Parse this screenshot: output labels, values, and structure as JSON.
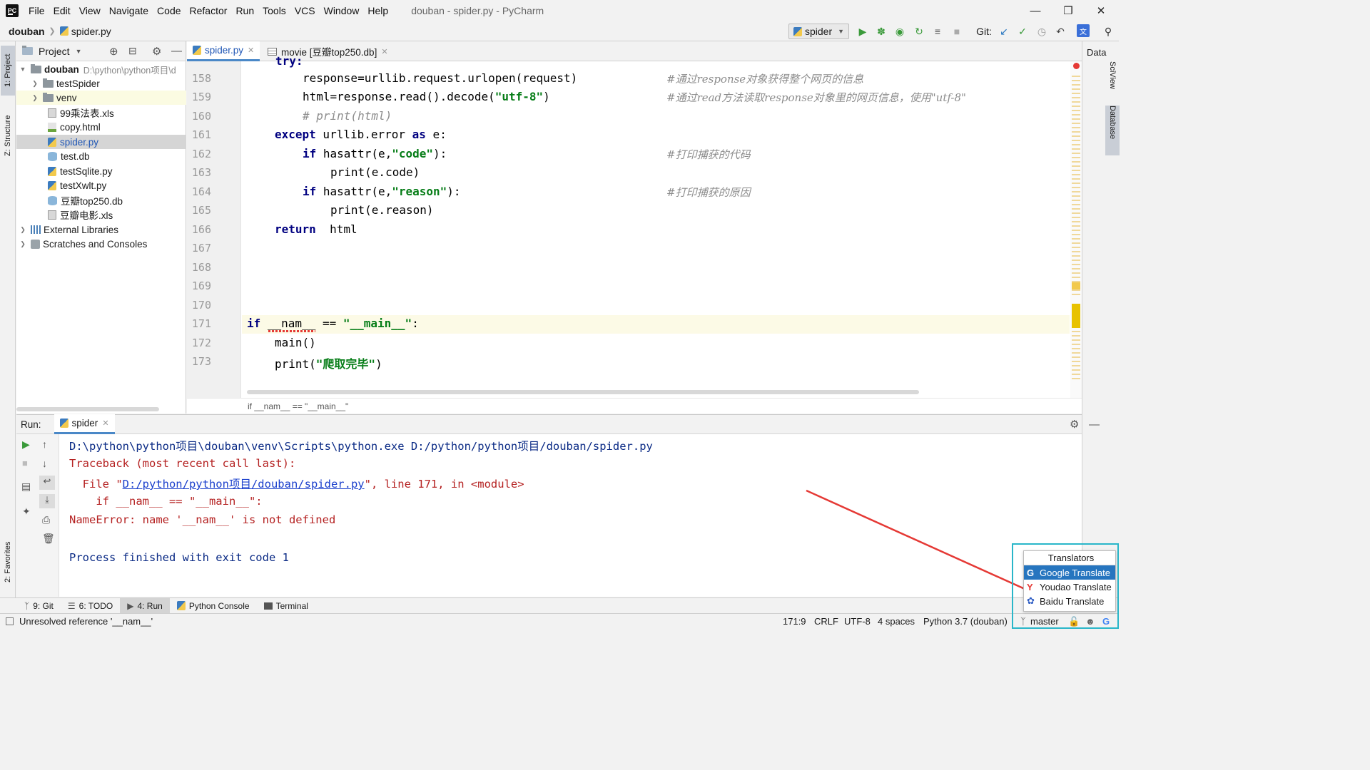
{
  "menu": {
    "items": [
      "File",
      "Edit",
      "View",
      "Navigate",
      "Code",
      "Refactor",
      "Run",
      "Tools",
      "VCS",
      "Window",
      "Help"
    ],
    "window_title": "douban - spider.py - PyCharm"
  },
  "nav": {
    "project": "douban",
    "file": "spider.py",
    "run_config": "spider",
    "git_label": "Git:"
  },
  "left_strip": {
    "project_tab": "1: Project",
    "structure_tab": "Z: Structure",
    "favorites_tab": "2: Favorites"
  },
  "right_strip": {
    "data_label": "Data",
    "sciview_tab": "SciView",
    "database_tab": "Database"
  },
  "project_panel": {
    "title": "Project",
    "tree": [
      {
        "name": "douban",
        "path": "D:\\python\\python项目\\d",
        "type": "root"
      },
      {
        "name": "testSpider",
        "type": "folder"
      },
      {
        "name": "venv",
        "type": "folder"
      },
      {
        "name": "99乘法表.xls",
        "type": "xls"
      },
      {
        "name": "copy.html",
        "type": "html"
      },
      {
        "name": "spider.py",
        "type": "py"
      },
      {
        "name": "test.db",
        "type": "db"
      },
      {
        "name": "testSqlite.py",
        "type": "py"
      },
      {
        "name": "testXwlt.py",
        "type": "py"
      },
      {
        "name": "豆瓣top250.db",
        "type": "db"
      },
      {
        "name": "豆瓣电影.xls",
        "type": "xls"
      },
      {
        "name": "External Libraries",
        "type": "lib"
      },
      {
        "name": "Scratches and Consoles",
        "type": "scratch"
      }
    ]
  },
  "editor": {
    "tabs": [
      {
        "label": "spider.py",
        "active": true
      },
      {
        "label": "movie [豆瓣top250.db]",
        "active": false
      }
    ],
    "top_partial": "try:",
    "lines": [
      {
        "n": "158",
        "code": "response=urllib.request.urlopen(request)",
        "comment": "#通过response对象获得整个网页的信息"
      },
      {
        "n": "159",
        "code": "html=response.read().decode(\"utf-8\")",
        "comment": "#通过read方法读取response对象里的网页信息，使用\"utf-8\""
      },
      {
        "n": "160",
        "code": "# print(html)",
        "comment": ""
      },
      {
        "n": "161",
        "code": "except urllib.error as e:",
        "comment": ""
      },
      {
        "n": "162",
        "code": "if hasattr(e,\"code\"):",
        "comment": "#打印捕获的代码"
      },
      {
        "n": "163",
        "code": "print(e.code)",
        "comment": ""
      },
      {
        "n": "164",
        "code": "if hasattr(e,\"reason\"):",
        "comment": "#打印捕获的原因"
      },
      {
        "n": "165",
        "code": "print(e.reason)",
        "comment": ""
      },
      {
        "n": "166",
        "code": "return  html",
        "comment": ""
      },
      {
        "n": "167",
        "code": "",
        "comment": ""
      },
      {
        "n": "168",
        "code": "",
        "comment": ""
      },
      {
        "n": "169",
        "code": "",
        "comment": ""
      },
      {
        "n": "170",
        "code": "",
        "comment": ""
      },
      {
        "n": "171",
        "code": "if __nam__ == \"__main__\":",
        "comment": ""
      },
      {
        "n": "172",
        "code": "main()",
        "comment": ""
      },
      {
        "n": "173",
        "code": "print(\"爬取完毕\")",
        "comment": ""
      }
    ],
    "breadcrumb": "if __nam__ == \"__main__\""
  },
  "run": {
    "label": "Run:",
    "tab": "spider",
    "output": [
      "D:\\python\\python项目\\douban\\venv\\Scripts\\python.exe D:/python/python项目/douban/spider.py",
      "Traceback (most recent call last):",
      "  File \"",
      "D:/python/python项目/douban/spider.py",
      "\", line 171, in <module>",
      "    if __nam__ == \"__main__\":",
      "NameError: name '__nam__' is not defined",
      "Process finished with exit code 1"
    ]
  },
  "bottom_tabs": [
    "9: Git",
    "6: TODO",
    "4: Run",
    "Python Console",
    "Terminal"
  ],
  "status": {
    "message": "Unresolved reference '__nam__'",
    "position": "171:9",
    "line_sep": "CRLF",
    "encoding": "UTF-8",
    "indent": "4 spaces",
    "interpreter": "Python 3.7 (douban)",
    "branch": "master"
  },
  "translators": {
    "title": "Translators",
    "items": [
      "Google Translate",
      "Youdao Translate",
      "Baidu Translate"
    ]
  },
  "colors": {
    "keyword": "#000080",
    "string": "#067d17",
    "error_red": "#b52222",
    "selection_blue": "#2675bf",
    "highlight_frame": "#29b6c9",
    "annotation_arrow": "#e53935"
  }
}
